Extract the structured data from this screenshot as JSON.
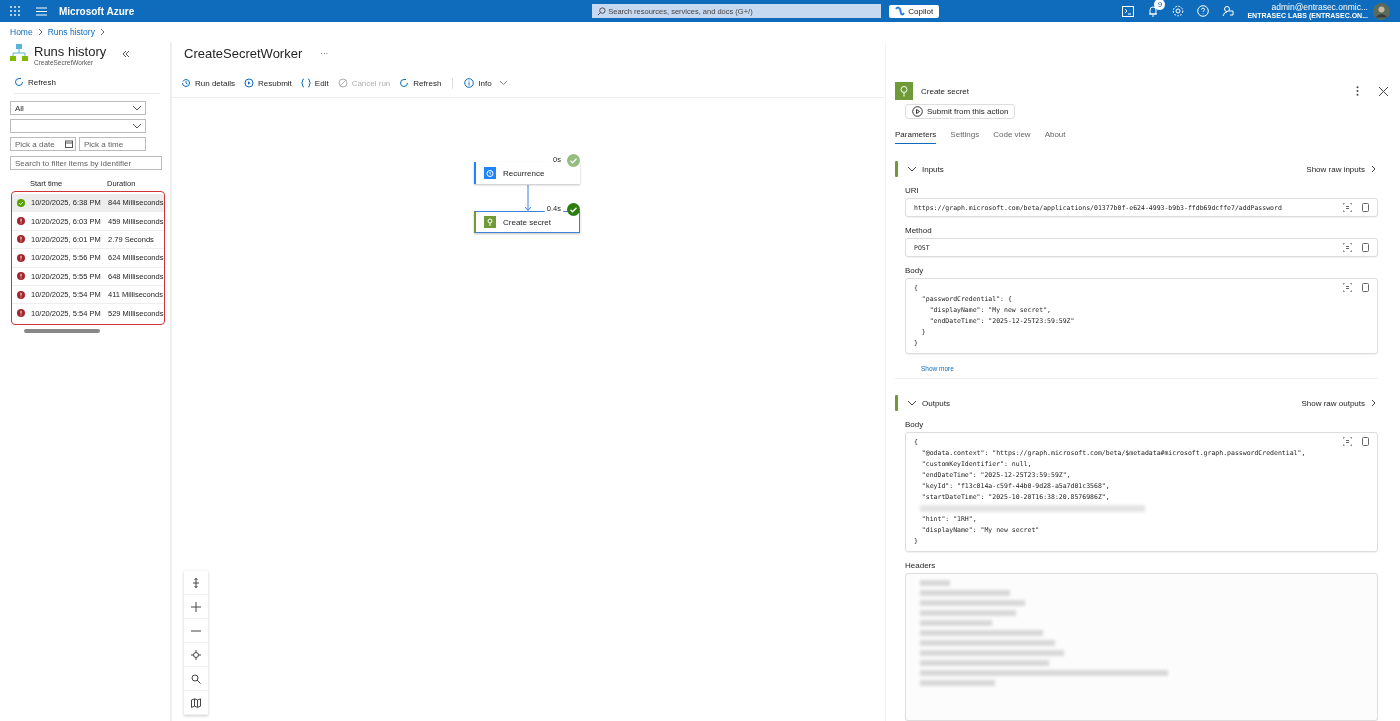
{
  "topbar": {
    "brand": "Microsoft Azure",
    "search": {
      "placeholder": "Search resources, services, and docs (G+/)"
    },
    "copilot": "Copilot",
    "notifications": "9",
    "account": {
      "email": "admin@entrasec.onmic...",
      "tenant": "ENTRASEC LABS (ENTRASEC.ON..."
    }
  },
  "breadcrumb": [
    "Home",
    "Runs history"
  ],
  "sidebar": {
    "title": "Runs history",
    "subtitle": "CreateSecretWorker",
    "refresh": "Refresh",
    "status_filter": {
      "value": "All"
    },
    "date": {
      "placeholder": "Pick a date"
    },
    "time": {
      "placeholder": "Pick a time"
    },
    "search": {
      "placeholder": "Search to filter items by identifier"
    },
    "columns": [
      "Start time",
      "Duration"
    ],
    "runs": [
      {
        "kind": "success",
        "start": "10/20/2025, 6:38 PM",
        "duration": "844 Milliseconds",
        "selected": true
      },
      {
        "kind": "failed",
        "start": "10/20/2025, 6:03 PM",
        "duration": "459 Milliseconds",
        "selected": false
      },
      {
        "kind": "failed",
        "start": "10/20/2025, 6:01 PM",
        "duration": "2.79 Seconds",
        "selected": false
      },
      {
        "kind": "failed",
        "start": "10/20/2025, 5:56 PM",
        "duration": "624 Milliseconds",
        "selected": false
      },
      {
        "kind": "failed",
        "start": "10/20/2025, 5:55 PM",
        "duration": "648 Milliseconds",
        "selected": false
      },
      {
        "kind": "failed",
        "start": "10/20/2025, 5:54 PM",
        "duration": "411 Milliseconds",
        "selected": false
      },
      {
        "kind": "failed",
        "start": "10/20/2025, 5:54 PM",
        "duration": "529 Milliseconds",
        "selected": false
      }
    ]
  },
  "workflow": {
    "title": "CreateSecretWorker",
    "more": "···",
    "toolbar": [
      {
        "kind": "history",
        "label": "Run details",
        "disabled": false
      },
      {
        "kind": "resubmit",
        "label": "Resubmit",
        "disabled": false
      },
      {
        "kind": "code",
        "label": "Edit",
        "disabled": false
      },
      {
        "kind": "cancel",
        "label": "Cancel run",
        "disabled": true
      },
      {
        "kind": "refresh",
        "label": "Refresh",
        "disabled": false
      },
      {
        "kind": "info",
        "label": "Info",
        "disabled": false
      }
    ],
    "nodes": [
      {
        "kind": "trigger",
        "label": "Recurrence",
        "time": "0s",
        "selected": false
      },
      {
        "kind": "action",
        "label": "Create secret",
        "time": "0.4s",
        "selected": true
      }
    ]
  },
  "details": {
    "title": "Create secret",
    "submit": "Submit from this action",
    "tabs": [
      {
        "label": "Parameters",
        "selected": true
      },
      {
        "label": "Settings",
        "selected": false
      },
      {
        "label": "Code view",
        "selected": false
      },
      {
        "label": "About",
        "selected": false
      }
    ],
    "inputs": {
      "heading": "Inputs",
      "raw": "Show raw inputs",
      "expanded": true,
      "uri_label": "URI",
      "uri": "https://graph.microsoft.com/beta/applications/01377b0f-e624-4993-b9b3-ffdb69dcffe7/addPassword",
      "method_label": "Method",
      "method": "POST",
      "body_label": "Body",
      "body": [
        {
          "kind": "code",
          "text": "{"
        },
        {
          "kind": "code",
          "text": "  \"passwordCredential\": {"
        },
        {
          "kind": "code",
          "text": "    \"displayName\": \"My new secret\","
        },
        {
          "kind": "code",
          "text": "    \"endDateTime\": \"2025-12-25T23:59:59Z\""
        },
        {
          "kind": "code",
          "text": "  }"
        },
        {
          "kind": "code",
          "text": "}"
        }
      ],
      "show_more": "Show more"
    },
    "outputs": {
      "heading": "Outputs",
      "raw": "Show raw outputs",
      "expanded": true,
      "body_label": "Body",
      "body": [
        {
          "kind": "code",
          "text": "{"
        },
        {
          "kind": "code",
          "text": "  \"@odata.context\": \"https://graph.microsoft.com/beta/$metadata#microsoft.graph.passwordCredential\","
        },
        {
          "kind": "code",
          "text": "  \"customKeyIdentifier\": null,"
        },
        {
          "kind": "code",
          "text": "  \"endDateTime\": \"2025-12-25T23:59:59Z\","
        },
        {
          "kind": "code",
          "text": "  \"keyId\": \"f13c014a-c59f-44b0-9d28-a5a7d01c3568\","
        },
        {
          "kind": "code",
          "text": "  \"startDateTime\": \"2025-10-20T16:38:20.8576986Z\","
        },
        {
          "kind": "redacted"
        },
        {
          "kind": "code",
          "text": "  \"hint\": \"1RH\","
        },
        {
          "kind": "code",
          "text": "  \"displayName\": \"My new secret\""
        },
        {
          "kind": "code",
          "text": "}"
        }
      ],
      "headers_label": "Headers"
    }
  }
}
